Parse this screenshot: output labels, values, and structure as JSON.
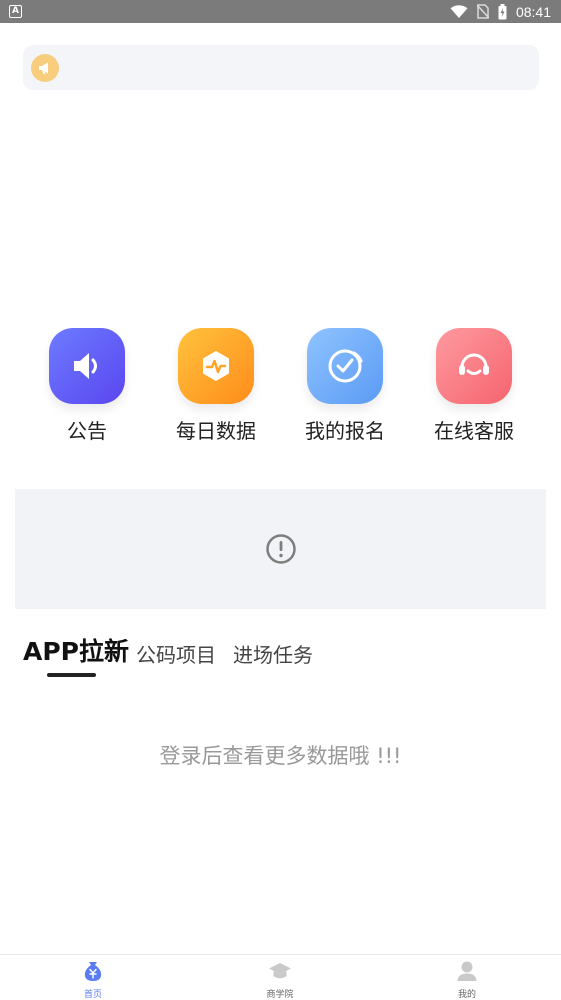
{
  "status_bar": {
    "time": "08:41",
    "left_badge": "A",
    "icons": [
      "wifi-icon",
      "no-sim-icon",
      "battery-charging-icon"
    ]
  },
  "notice": {
    "icon": "megaphone-icon",
    "icon_color": "#f8cd7d",
    "text": ""
  },
  "quick_menu": [
    {
      "label": "公告",
      "icon": "speaker-icon",
      "color_from": "#6d7bff",
      "color_to": "#5a46f0"
    },
    {
      "label": "每日数据",
      "icon": "pulse-hexagon-icon",
      "color_from": "#ffc23d",
      "color_to": "#ff8c1a"
    },
    {
      "label": "我的报名",
      "icon": "check-circle-icon",
      "color_from": "#8fc3ff",
      "color_to": "#5b9bf5"
    },
    {
      "label": "在线客服",
      "icon": "headset-icon",
      "color_from": "#ff9aa0",
      "color_to": "#f5646e"
    }
  ],
  "banner": {
    "icon": "alert-circle-icon"
  },
  "tabs": {
    "items": [
      "APP拉新",
      "公码项目",
      "进场任务"
    ],
    "active_index": 0
  },
  "empty_message": "登录后查看更多数据哦 !!!",
  "bottom_nav": {
    "active_color": "#5b7bf0",
    "items": [
      {
        "label": "首页",
        "icon": "money-bag-icon"
      },
      {
        "label": "商学院",
        "icon": "graduation-cap-icon"
      },
      {
        "label": "我的",
        "icon": "user-icon"
      }
    ]
  }
}
